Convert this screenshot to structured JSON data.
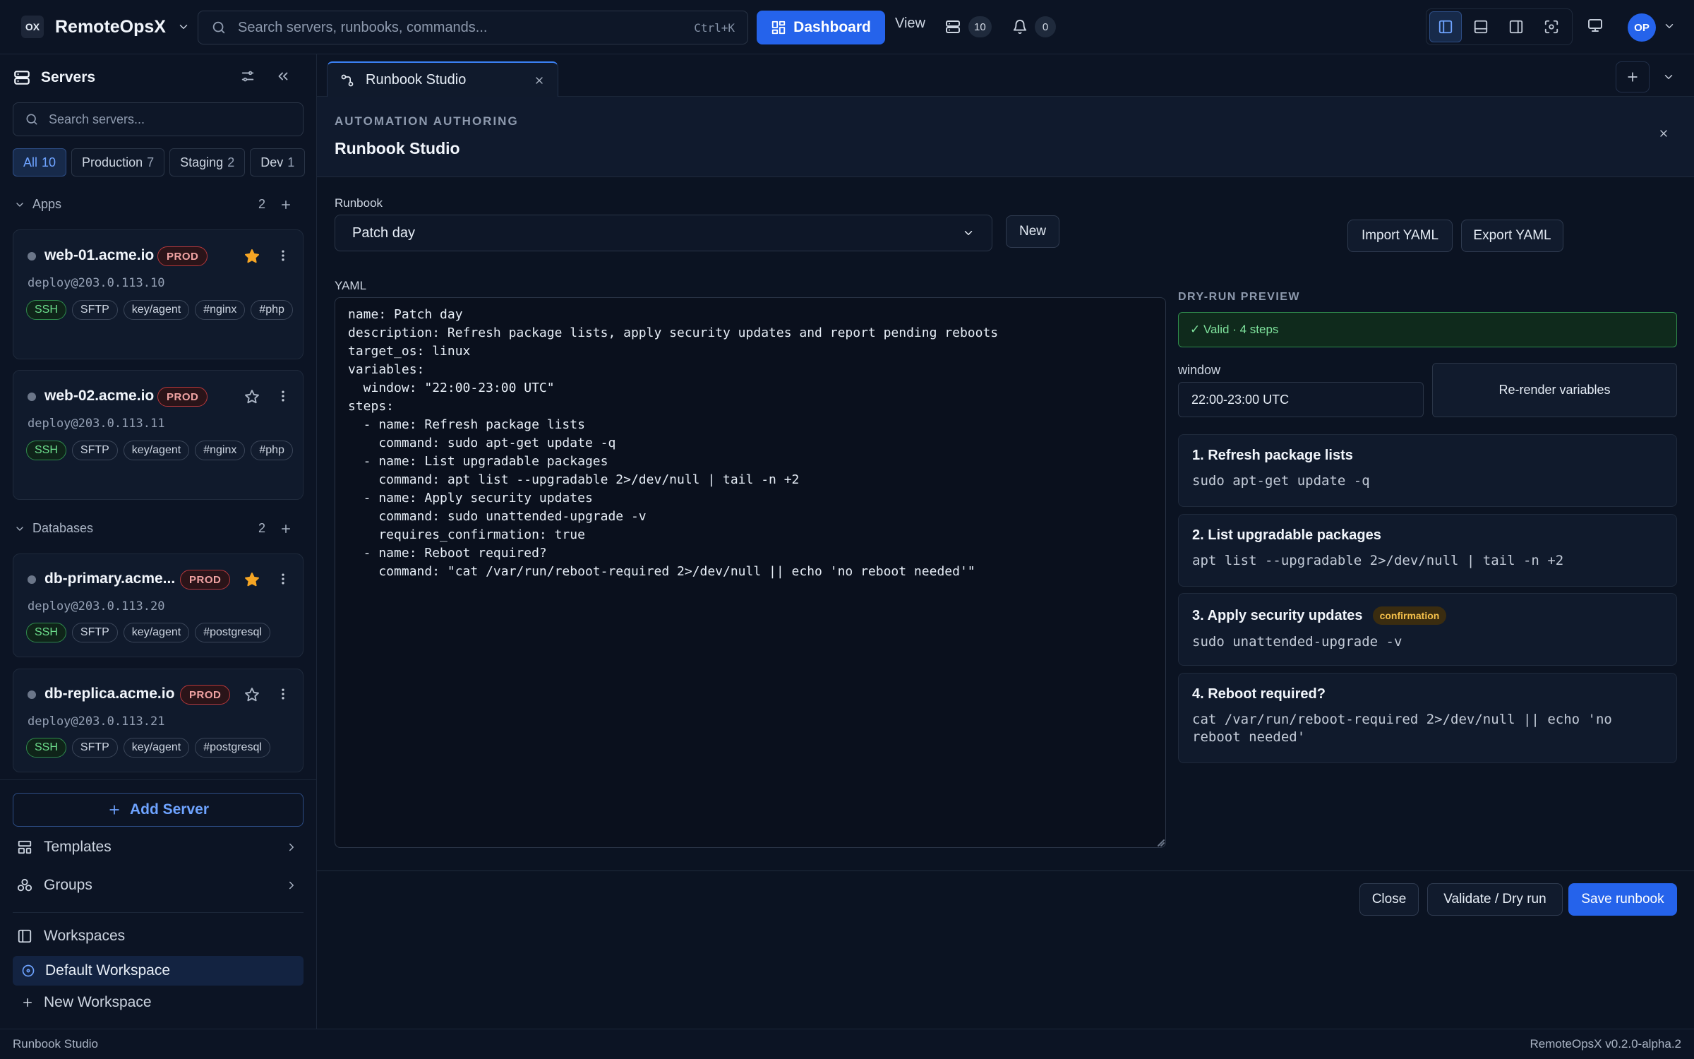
{
  "app": {
    "name": "RemoteOpsX",
    "logo_text": "OX",
    "search_placeholder": "Search servers, runbooks, commands...",
    "search_shortcut": "Ctrl+K",
    "dashboard_label": "Dashboard",
    "view_label": "View",
    "server_count": "10",
    "notification_count": "0",
    "avatar_initials": "OP",
    "accent_color": "#2563eb"
  },
  "sidebar": {
    "title": "Servers",
    "search_placeholder": "Search servers...",
    "filters": [
      {
        "label": "All",
        "count": "10"
      },
      {
        "label": "Production",
        "count": "7"
      },
      {
        "label": "Staging",
        "count": "2"
      },
      {
        "label": "Dev",
        "count": "1"
      }
    ],
    "groups": [
      {
        "name": "Apps",
        "count": "2"
      },
      {
        "name": "Databases",
        "count": "2"
      }
    ],
    "servers": [
      {
        "host": "web-01.acme.io",
        "env": "PROD",
        "starred": true,
        "user": "deploy@203.0.113.10",
        "tags": [
          "SSH",
          "SFTP",
          "key/agent",
          "#nginx",
          "#php"
        ]
      },
      {
        "host": "web-02.acme.io",
        "env": "PROD",
        "starred": false,
        "user": "deploy@203.0.113.11",
        "tags": [
          "SSH",
          "SFTP",
          "key/agent",
          "#nginx",
          "#php"
        ]
      },
      {
        "host": "db-primary.acme...",
        "env": "PROD",
        "starred": true,
        "user": "deploy@203.0.113.20",
        "tags": [
          "SSH",
          "SFTP",
          "key/agent",
          "#postgresql"
        ]
      },
      {
        "host": "db-replica.acme.io",
        "env": "PROD",
        "starred": false,
        "user": "deploy@203.0.113.21",
        "tags": [
          "SSH",
          "SFTP",
          "key/agent",
          "#postgresql"
        ]
      }
    ],
    "add_server_label": "Add Server",
    "templates_label": "Templates",
    "groups_label": "Groups",
    "workspaces_label": "Workspaces",
    "workspaces": [
      "Default Workspace"
    ],
    "new_workspace_label": "New Workspace"
  },
  "tab": {
    "label": "Runbook Studio"
  },
  "panel": {
    "eyebrow": "AUTOMATION AUTHORING",
    "title": "Runbook Studio",
    "runbook_label": "Runbook",
    "runbook_selected": "Patch day",
    "new_label": "New",
    "import_label": "Import YAML",
    "export_label": "Export YAML",
    "yaml_label": "YAML",
    "yaml": "name: Patch day\ndescription: Refresh package lists, apply security updates and report pending reboots\ntarget_os: linux\nvariables:\n  window: \"22:00-23:00 UTC\"\nsteps:\n  - name: Refresh package lists\n    command: sudo apt-get update -q\n  - name: List upgradable packages\n    command: apt list --upgradable 2>/dev/null | tail -n +2\n  - name: Apply security updates\n    command: sudo unattended-upgrade -v\n    requires_confirmation: true\n  - name: Reboot required?\n    command: \"cat /var/run/reboot-required 2>/dev/null || echo 'no reboot needed'\"",
    "preview_label": "DRY-RUN PREVIEW",
    "valid_text": "✓ Valid · 4 steps",
    "variable_name": "window",
    "variable_value": "22:00-23:00 UTC",
    "rerender_label": "Re-render variables",
    "steps": [
      {
        "title": "1. Refresh package lists",
        "command": "sudo apt-get update -q",
        "badge": ""
      },
      {
        "title": "2. List upgradable packages",
        "command": "apt list --upgradable 2>/dev/null | tail -n +2",
        "badge": ""
      },
      {
        "title": "3. Apply security updates",
        "command": "sudo unattended-upgrade -v",
        "badge": "confirmation"
      },
      {
        "title": "4. Reboot required?",
        "command": "cat /var/run/reboot-required 2>/dev/null || echo 'no\nreboot needed'",
        "badge": ""
      }
    ],
    "close_label": "Close",
    "validate_label": "Validate / Dry run",
    "save_label": "Save runbook"
  },
  "status": {
    "left": "Runbook Studio",
    "right": "RemoteOpsX v0.2.0-alpha.2"
  }
}
